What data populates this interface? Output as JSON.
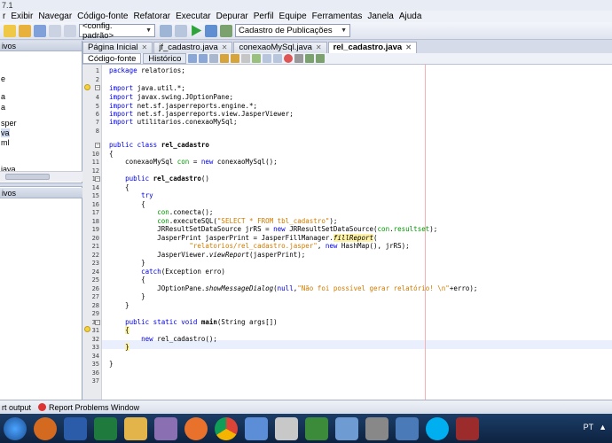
{
  "window": {
    "title": "7.1"
  },
  "menu": {
    "items": [
      "r",
      "Exibir",
      "Navegar",
      "Código-fonte",
      "Refatorar",
      "Executar",
      "Depurar",
      "Perfil",
      "Equipe",
      "Ferramentas",
      "Janela",
      "Ajuda"
    ]
  },
  "toolbar": {
    "config_select": "<config. padrão>",
    "target_select": "Cadastro de Publicações"
  },
  "left_panel": {
    "header": "ivos",
    "items": [
      "e",
      "a",
      "a",
      "sper",
      "va",
      "ml",
      "java"
    ],
    "header2": "ivos"
  },
  "editor_tabs": [
    {
      "label": "Página Inicial",
      "active": false
    },
    {
      "label": "jf_cadastro.java",
      "active": false
    },
    {
      "label": "conexaoMySql.java",
      "active": false
    },
    {
      "label": "rel_cadastro.java",
      "active": true
    }
  ],
  "subtabs": {
    "source": "Código-fonte",
    "history": "Histórico"
  },
  "code": {
    "line_numbers": [
      "1",
      "2",
      "3",
      "4",
      "5",
      "6",
      "7",
      "8",
      "9",
      "10",
      "11",
      "12",
      "13",
      "14",
      "15",
      "16",
      "17",
      "18",
      "19",
      "20",
      "21",
      "22",
      "23",
      "24",
      "25",
      "26",
      "27",
      "28",
      "29",
      "30",
      "31",
      "32",
      "33",
      "34",
      "35",
      "36",
      "37"
    ]
  },
  "statusbar": {
    "output": "rt output",
    "report": "Report Problems Window"
  },
  "taskbar": {
    "locale": "PT"
  }
}
